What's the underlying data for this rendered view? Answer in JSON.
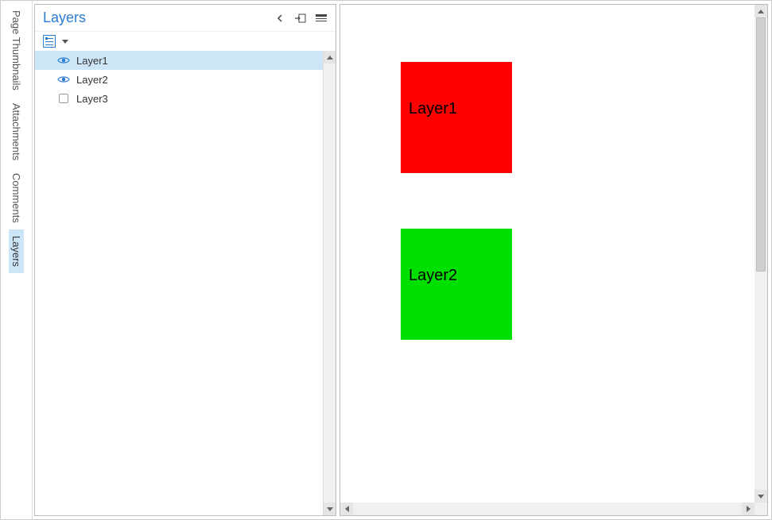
{
  "tabs": {
    "page_thumbnails": "Page Thumbnails",
    "attachments": "Attachments",
    "comments": "Comments",
    "layers": "Layers"
  },
  "panel": {
    "title": "Layers"
  },
  "layers": [
    {
      "name": "Layer1",
      "visible": true,
      "selected": true
    },
    {
      "name": "Layer2",
      "visible": true,
      "selected": false
    },
    {
      "name": "Layer3",
      "visible": false,
      "selected": false
    }
  ],
  "document": {
    "boxes": [
      {
        "label": "Layer1",
        "color": "red"
      },
      {
        "label": "Layer2",
        "color": "green"
      }
    ]
  }
}
